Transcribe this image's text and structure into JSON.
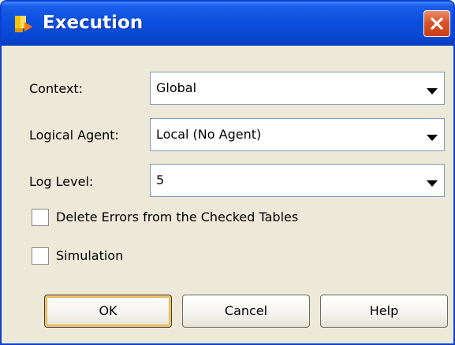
{
  "window": {
    "title": "Execution",
    "title_bar_color": "#0a4fdf",
    "close_button_color": "#d9542a",
    "app_icon": "execution-app-icon",
    "close_icon": "close-x-icon"
  },
  "fields": {
    "context": {
      "label": "Context:",
      "value": "Global"
    },
    "logical_agent": {
      "label": "Logical Agent:",
      "value": "Local (No Agent)"
    },
    "log_level": {
      "label": "Log Level:",
      "value": "5"
    }
  },
  "checkboxes": {
    "delete_errors": {
      "label": "Delete Errors from the Checked Tables",
      "checked": false
    },
    "simulation": {
      "label": "Simulation",
      "checked": false
    }
  },
  "buttons": {
    "ok": "OK",
    "cancel": "Cancel",
    "help": "Help"
  }
}
